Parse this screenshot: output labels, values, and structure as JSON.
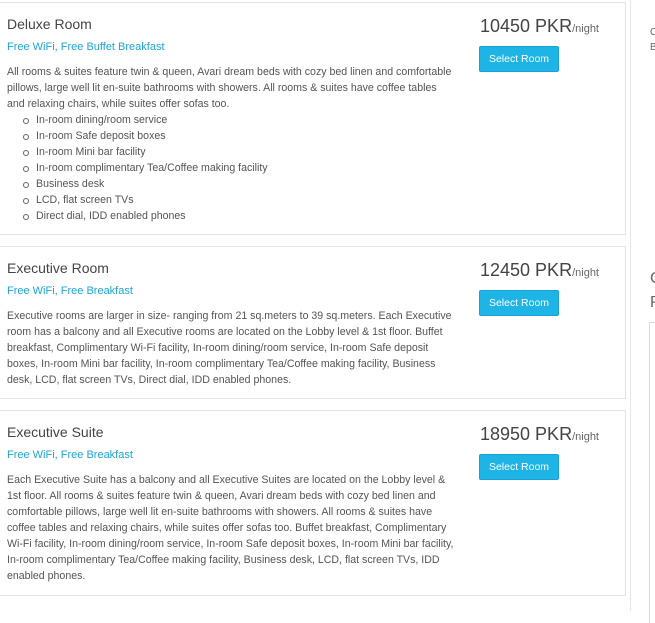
{
  "rooms": [
    {
      "title": "Deluxe Room",
      "amenities": "Free WiFi, Free Buffet Breakfast",
      "description": "All rooms & suites feature twin & queen, Avari dream beds with cozy bed linen and comfortable pillows, large well lit en-suite bathrooms with showers. All rooms & suites have coffee tables and relaxing chairs, while suites offer sofas too.",
      "features": [
        "In-room dining/room service",
        "In-room Safe deposit boxes",
        "In-room Mini bar facility",
        "In-room complimentary Tea/Coffee making facility",
        "Business desk",
        "LCD, flat screen TVs",
        "Direct dial, IDD enabled phones"
      ],
      "price": "10450 PKR",
      "price_unit": "/night",
      "button_label": "Select Room"
    },
    {
      "title": "Executive Room",
      "amenities": "Free WiFi, Free Breakfast",
      "description": "Executive rooms are larger in size- ranging from 21 sq.meters to 39 sq.meters. Each Executive room has a balcony and all Executive rooms are located on the Lobby level & 1st floor. Buffet breakfast, Complimentary Wi-Fi facility, In-room dining/room service, In-room Safe deposit boxes, In-room Mini bar facility, In-room complimentary Tea/Coffee making facility, Business desk, LCD, flat screen TVs, Direct dial, IDD enabled phones.",
      "price": "12450 PKR",
      "price_unit": "/night",
      "button_label": "Select Room"
    },
    {
      "title": "Executive Suite",
      "amenities": "Free WiFi, Free Breakfast",
      "description": "Each Executive Suite has a balcony and all Executive Suites are located on the Lobby level & 1st floor. All rooms & suites feature twin & queen, Avari dream beds with cozy bed linen and comfortable pillows, large well lit en-suite bathrooms with showers. All rooms & suites have coffee tables and relaxing chairs, while suites offer sofas too. Buffet breakfast, Complimentary Wi-Fi facility, In-room dining/room service, In-room Safe deposit boxes, In-room Mini bar facility, In-room complimentary Tea/Coffee making facility, Business desk, LCD, flat screen TVs, IDD enabled phones.",
      "price": "18950 PKR",
      "price_unit": "/night",
      "button_label": "Select Room"
    }
  ],
  "sidebar": {
    "fragment_top_1": "C",
    "fragment_top_2": "B",
    "fragment_mid_1": "C",
    "fragment_mid_2": "P"
  }
}
